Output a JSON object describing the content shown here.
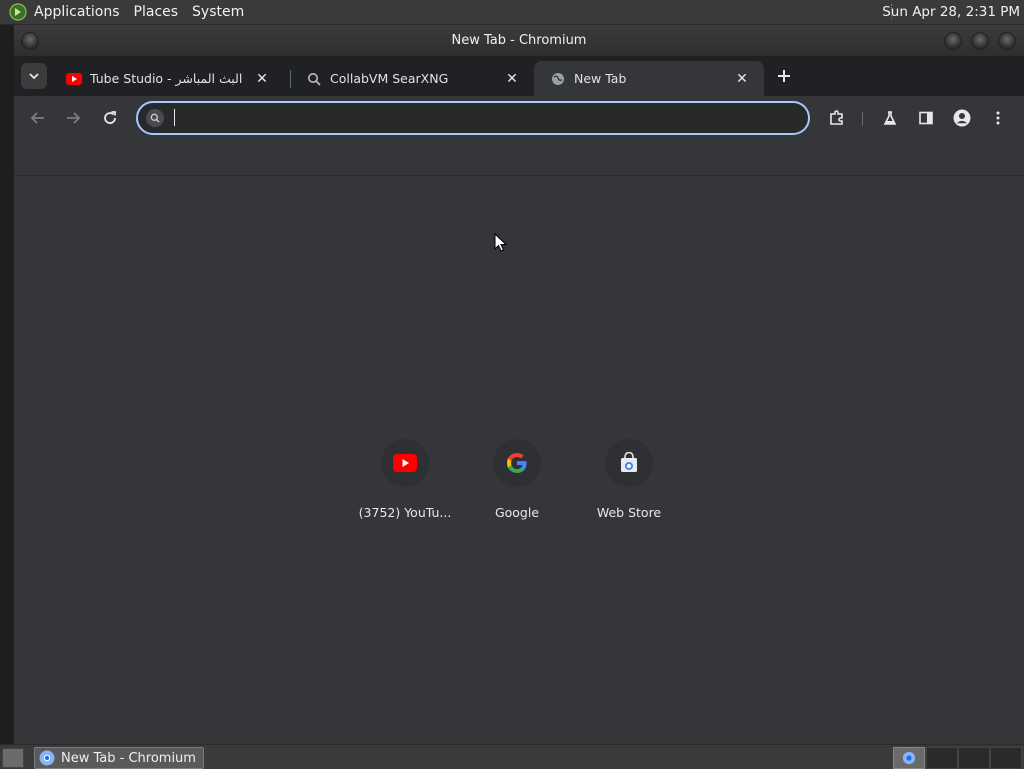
{
  "top_panel": {
    "menus": [
      "Applications",
      "Places",
      "System"
    ],
    "clock": "Sun Apr 28,  2:31 PM"
  },
  "window": {
    "title": "New Tab - Chromium"
  },
  "tabs": [
    {
      "title": "Tube Studio - البث المباشر",
      "icon": "youtube-icon",
      "active": false
    },
    {
      "title": "CollabVM SearXNG",
      "icon": "searxng-icon",
      "active": false
    },
    {
      "title": "New Tab",
      "icon": "globe-icon",
      "active": true
    }
  ],
  "toolbar": {
    "omnibox_value": "",
    "omnibox_placeholder": ""
  },
  "shortcuts": [
    {
      "label": "(3752) YouTu...",
      "icon": "youtube-icon"
    },
    {
      "label": "Google",
      "icon": "google-icon"
    },
    {
      "label": "Web Store",
      "icon": "web-store-icon"
    }
  ],
  "taskbar": {
    "window_button": "New Tab - Chromium"
  },
  "colors": {
    "accent": "#a8c7fa",
    "youtube_red": "#ff0000",
    "content_bg": "#35363a"
  }
}
